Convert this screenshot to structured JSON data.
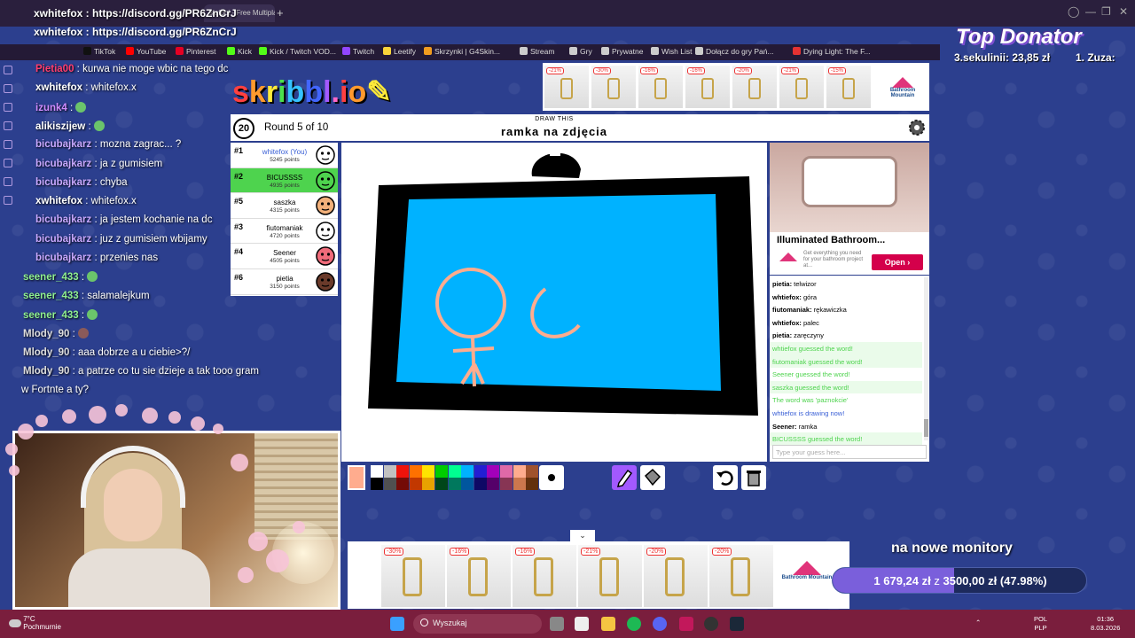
{
  "browser": {
    "tab_title": "skribbl - Free Multiplayer D...",
    "url_overlay": "https://discord.gg/PR6ZnCrJ",
    "bookmarks": [
      {
        "label": "TikTok",
        "color": "#111111"
      },
      {
        "label": "YouTube",
        "color": "#ff0000"
      },
      {
        "label": "Pinterest",
        "color": "#e60023"
      },
      {
        "label": "Kick",
        "color": "#53fc18"
      },
      {
        "label": "Kick / Twitch VOD...",
        "color": "#53fc18"
      },
      {
        "label": "Twitch",
        "color": "#9146ff"
      },
      {
        "label": "Leetify",
        "color": "#f8d43a"
      },
      {
        "label": "Skrzynki | G4Skin...",
        "color": "#f29c1f"
      },
      {
        "label": "Stream",
        "color": "#cccccc"
      },
      {
        "label": "Gry",
        "color": "#cccccc"
      },
      {
        "label": "Prywatne",
        "color": "#cccccc"
      },
      {
        "label": "Wish List",
        "color": "#cccccc"
      },
      {
        "label": "Dołącz do gry Pań...",
        "color": "#cccccc"
      },
      {
        "label": "Dying Light: The F...",
        "color": "#e63232"
      }
    ]
  },
  "stream_overlay": {
    "discord_line_1": "xwhitefox : https://discord.gg/PR6ZnCrJ",
    "discord_line_2": "xwhitefox : https://discord.gg/PR6ZnCrJ",
    "top_donator_title": "Top Donator",
    "donors": [
      "3.sekulinii: 23,85 zł",
      "1. Zuza: "
    ],
    "goal_title": "na nowe monitory",
    "goal_current": "1 679,24 zł",
    "goal_separator": "z",
    "goal_target": "3500,00 zł",
    "goal_percent_label": "(47.98%)",
    "goal_fraction": 0.4798
  },
  "twitch_chat": [
    {
      "user": "Pietia00",
      "color": "#ff3d6e",
      "text": " : kurwa nie moge wbic na tego dc"
    },
    {
      "user": "xwhitefox",
      "color": "#ffffff",
      "text": " : whitefox.x"
    },
    {
      "user": "izunk4",
      "color": "#d08bff",
      "text": " : ",
      "emote": "#6bc46b"
    },
    {
      "user": "alikiszijew",
      "color": "#ffffff",
      "text": " : ",
      "emote": "#6bc46b"
    },
    {
      "user": "bicubajkarz",
      "color": "#c8a8ff",
      "text": " : mozna zagrac... ?"
    },
    {
      "user": "bicubajkarz",
      "color": "#c8a8ff",
      "text": " : ja z gumisiem"
    },
    {
      "user": "bicubajkarz",
      "color": "#c8a8ff",
      "text": " : chyba"
    },
    {
      "user": "xwhitefox",
      "color": "#ffffff",
      "text": " : whitefox.x"
    },
    {
      "user": "bicubajkarz",
      "color": "#c8a8ff",
      "text": " : ja jestem kochanie na dc"
    },
    {
      "user": "bicubajkarz",
      "color": "#c8a8ff",
      "text": " : juz z gumisiem wbijamy"
    },
    {
      "user": "bicubajkarz",
      "color": "#c8a8ff",
      "text": " : przenies nas"
    },
    {
      "user": "seener_433",
      "color": "#8ff08f",
      "text": " : ",
      "emote": "#6bc46b"
    },
    {
      "user": "seener_433",
      "color": "#8ff08f",
      "text": " : salamalejkum"
    },
    {
      "user": "seener_433",
      "color": "#8ff08f",
      "text": " : ",
      "emote": "#6bc46b"
    },
    {
      "user": "Mlody_90",
      "color": "#dddddd",
      "text": " : ",
      "emote": "#8a5a5a"
    },
    {
      "user": "Mlody_90",
      "color": "#dddddd",
      "text": " : aaa dobrze a u ciebie>?/"
    },
    {
      "user": "Mlody_90",
      "color": "#dddddd",
      "text": " : a patrze co tu sie dzieje a tak tooo gram"
    },
    {
      "user": "",
      "color": "#ffffff",
      "text": "w Fortnte a ty?"
    }
  ],
  "game": {
    "logo": "skribbl.io",
    "timer": "20",
    "round_label": "Round 5 of 10",
    "draw_this_label": "DRAW THIS",
    "word": "ramka na zdjęcia",
    "players": [
      {
        "rank": "#1",
        "name": "whitefox (You)",
        "points": "5245 points",
        "guessed": false,
        "avatar_color": "#ffffff",
        "name_color": "#3a60d6"
      },
      {
        "rank": "#2",
        "name": "BICUSSSS",
        "points": "4935 points",
        "guessed": true,
        "avatar_color": "#4ed34e",
        "name_color": "#000000"
      },
      {
        "rank": "#5",
        "name": "saszka",
        "points": "4315 points",
        "guessed": false,
        "avatar_color": "#f2b07a",
        "name_color": "#000000"
      },
      {
        "rank": "#3",
        "name": "fiutomaniak",
        "points": "4720 points",
        "guessed": false,
        "avatar_color": "#ffffff",
        "name_color": "#000000"
      },
      {
        "rank": "#4",
        "name": "Seener",
        "points": "4505 points",
        "guessed": false,
        "avatar_color": "#f06b7a",
        "name_color": "#000000"
      },
      {
        "rank": "#6",
        "name": "pietia",
        "points": "3150 points",
        "guessed": false,
        "avatar_color": "#6a3a2a",
        "name_color": "#000000"
      }
    ],
    "chat_messages": [
      {
        "name": "pietia:",
        "text": " telwizor",
        "style": "n"
      },
      {
        "name": "whtiefox:",
        "text": " góra",
        "style": "n"
      },
      {
        "name": "fiutomaniak:",
        "text": " rękawiczka",
        "style": "n"
      },
      {
        "name": "whtiefox:",
        "text": " palec",
        "style": "n"
      },
      {
        "name": "pietia:",
        "text": " zaręczyny",
        "style": "n"
      },
      {
        "name": "",
        "text": "whtiefox guessed the word!",
        "style": "g"
      },
      {
        "name": "",
        "text": "fiutomaniak guessed the word!",
        "style": "g"
      },
      {
        "name": "",
        "text": "Seener guessed the word!",
        "style": "g2"
      },
      {
        "name": "",
        "text": "saszka guessed the word!",
        "style": "g"
      },
      {
        "name": "",
        "text": "The word was 'paznokcie'",
        "style": "g2"
      },
      {
        "name": "",
        "text": "whtiefox is drawing now!",
        "style": "b"
      },
      {
        "name": "Seener:",
        "text": " ramka",
        "style": "n"
      },
      {
        "name": "",
        "text": "BICUSSSS guessed the word!",
        "style": "g"
      }
    ],
    "guess_placeholder": "Type your guess here...",
    "palette": [
      "#ffffff",
      "#c1c1c1",
      "#ef130b",
      "#ff7100",
      "#ffe400",
      "#00cc00",
      "#00ff91",
      "#00b2ff",
      "#231fd3",
      "#a300ba",
      "#df69a7",
      "#ffac8e",
      "#a0522d",
      "#000000",
      "#505050",
      "#740b07",
      "#c23800",
      "#e8a200",
      "#004619",
      "#00785d",
      "#00569e",
      "#0e0865",
      "#550069",
      "#873554",
      "#cc774d",
      "#63300d"
    ]
  },
  "ads": {
    "side_title": "Illuminated Bathroom...",
    "side_sub": "Get everything you need for your bathroom project at...",
    "open_label": "Open",
    "brand": "Bathroom Mountain",
    "top_badges": [
      "-21%",
      "-30%",
      "-16%",
      "-16%",
      "-20%",
      "-21%",
      "-15%"
    ],
    "bottom_badges": [
      "-30%",
      "-16%",
      "-16%",
      "-21%",
      "-20%",
      "-20%"
    ]
  },
  "taskbar": {
    "weather_temp": "7°C",
    "weather_desc": "Pochmurnie",
    "search_label": "Wyszukaj",
    "lang_1": "POL",
    "lang_2": "PLP",
    "time": "01:36",
    "date": "8.03.2026"
  }
}
